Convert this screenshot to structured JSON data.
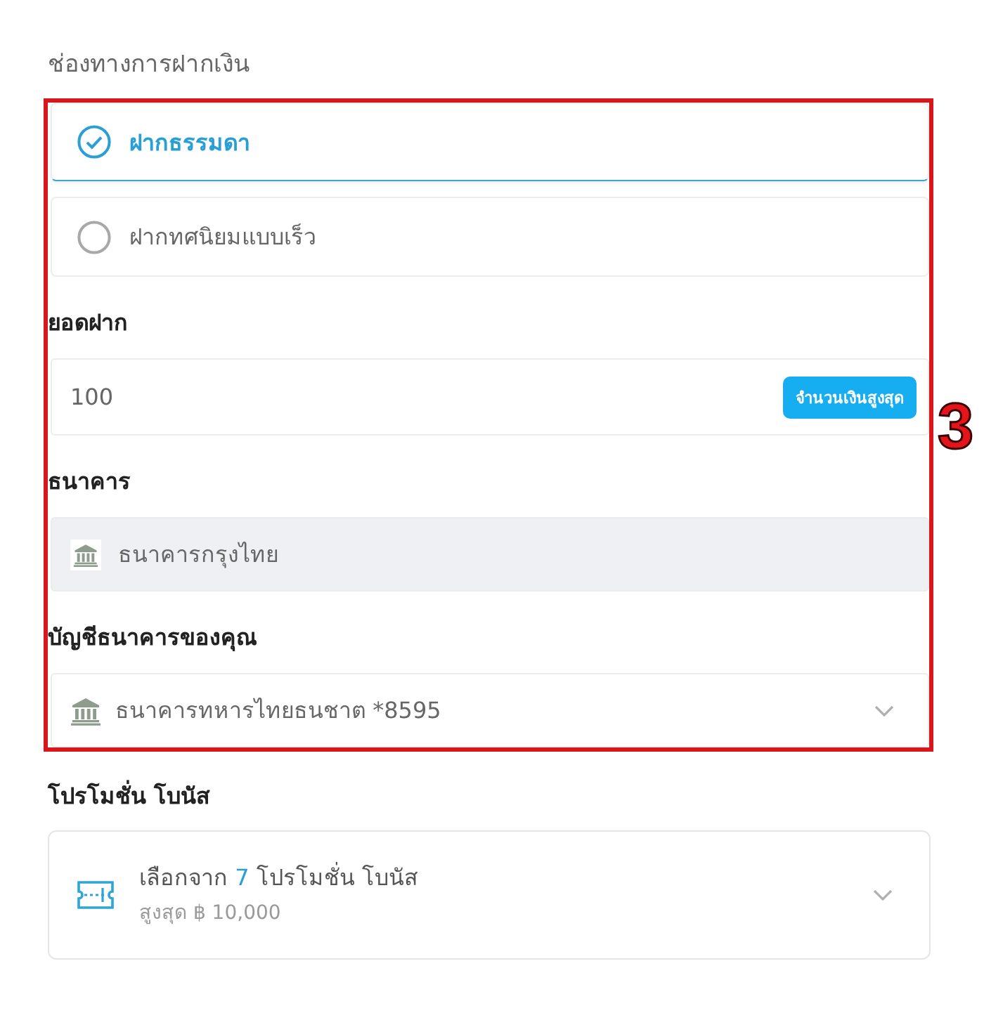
{
  "section_title": "ช่องทางการฝากเงิน",
  "annotation": {
    "label": "3"
  },
  "deposit_options": [
    {
      "label": "ฝากธรรมดา",
      "selected": true
    },
    {
      "label": "ฝากทศนิยมแบบเร็ว",
      "selected": false
    }
  ],
  "fields": [
    {
      "kind": "input",
      "label": "ยอดฝาก",
      "value": "100",
      "button": "จำนวนเงินสูงสุด"
    },
    {
      "kind": "bank",
      "label": "ธนาคาร",
      "value": "ธนาคารกรุงไทย",
      "disabled": true
    },
    {
      "kind": "select",
      "label": "บัญชีธนาคารของคุณ",
      "value": "ธนาคารทหารไทยธนชาต *8595",
      "expanded": false
    }
  ],
  "promotion": {
    "label": "โปรโมชั่น โบนัส",
    "text_before": "เลือกจาก",
    "count": "7",
    "text_after": "โปรโมชั่น โบนัส",
    "max": "สูงสุด ฿ 10,000",
    "expanded": false
  }
}
